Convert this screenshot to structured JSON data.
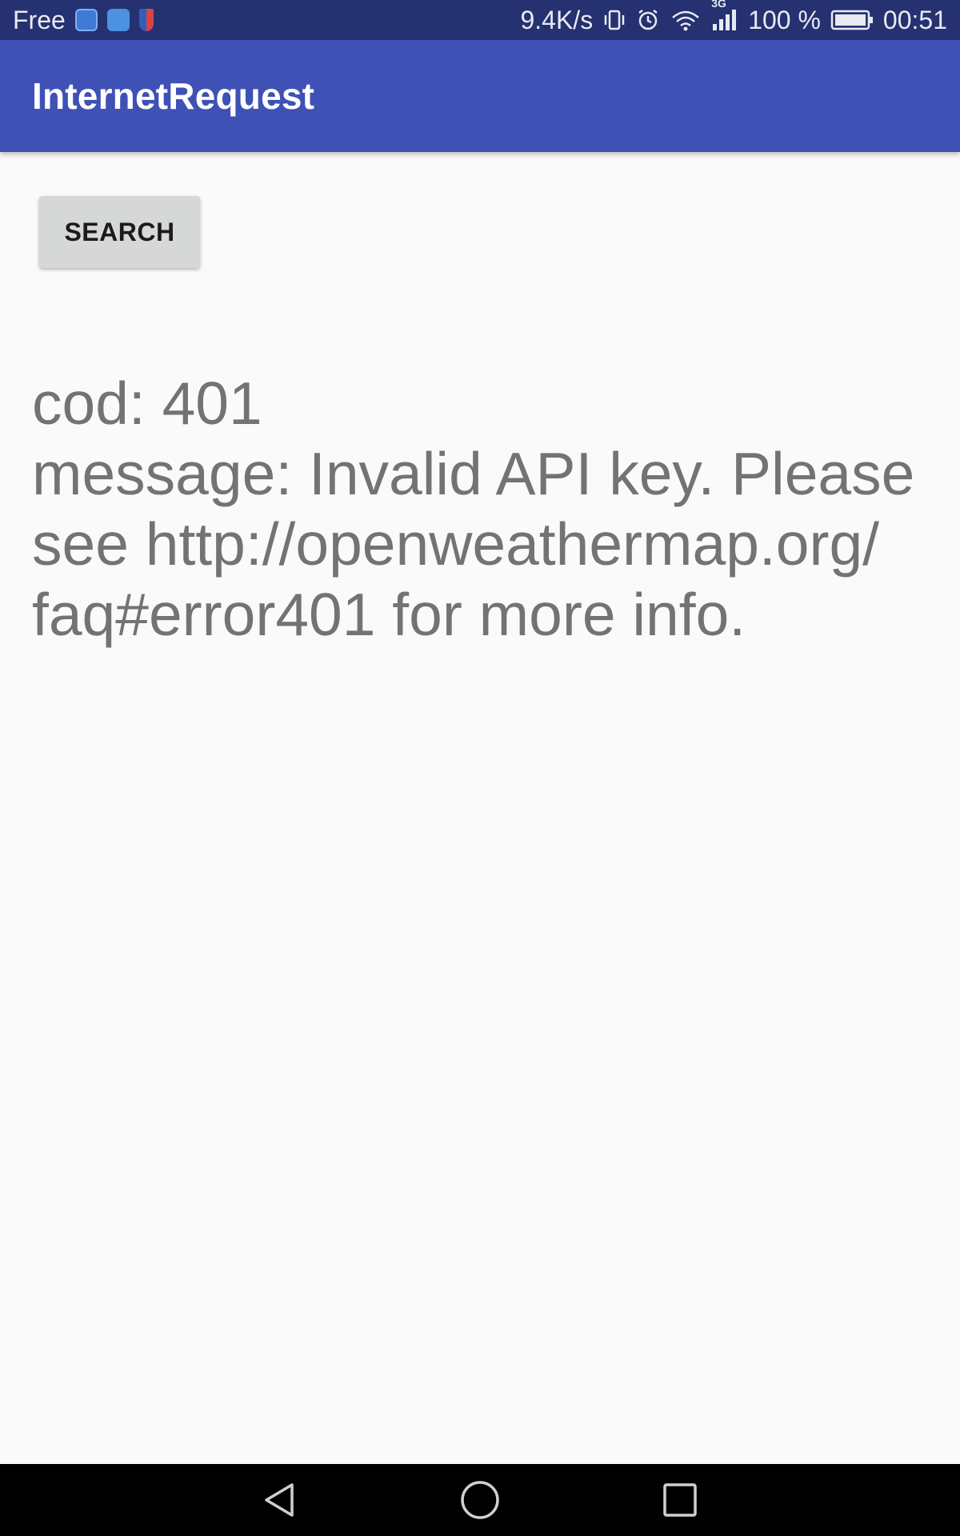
{
  "status_bar": {
    "carrier": "Free",
    "net_speed": "9.4K/s",
    "network_type": "3G",
    "battery": "100 %",
    "time": "00:51",
    "icons": [
      "app-notification-icon",
      "messenger-icon",
      "shield-icon",
      "vibrate-icon",
      "alarm-icon",
      "wifi-icon",
      "cell-signal-icon",
      "battery-icon"
    ]
  },
  "app_bar": {
    "title": "InternetRequest",
    "color": "#3f51b5"
  },
  "main": {
    "search_label": "SEARCH",
    "result_lines": [
      "cod: 401",
      "message: Invalid API key. Please",
      "see http://openweathermap.org/",
      "faq#error401 for more info."
    ]
  },
  "nav_bar": {
    "icons": [
      "back-icon",
      "home-icon",
      "recents-icon"
    ]
  }
}
